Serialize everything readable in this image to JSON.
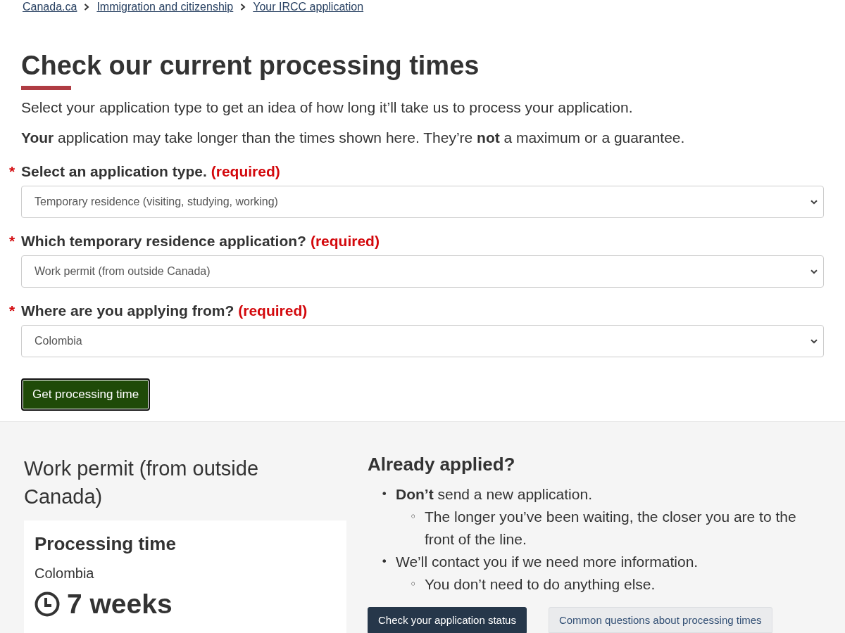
{
  "breadcrumb": [
    "Canada.ca",
    "Immigration and citizenship",
    "Your IRCC application"
  ],
  "page_title": "Check our current processing times",
  "intro": "Select your application type to get an idea of how long it’ll take us to process your application.",
  "notice": "**Your** application may take longer than the times shown here. They’re **not** a maximum or a guarantee.",
  "form": {
    "fields": [
      {
        "marker": "*",
        "label": "Select an application type.",
        "required_note": "(required)",
        "value": "Temporary residence (visiting, studying, working)"
      },
      {
        "marker": "*",
        "label": "Which temporary residence application?",
        "required_note": "(required)",
        "value": "Work permit (from outside Canada)"
      },
      {
        "marker": "*",
        "label": "Where are you applying from?",
        "required_note": "(required)",
        "value": "Colombia"
      }
    ],
    "submit_button": "Get processing time"
  },
  "result": {
    "heading": "Work permit (from outside Canada)",
    "card": {
      "title": "Processing time",
      "country": "Colombia",
      "time": "7 weeks"
    }
  },
  "already_applied": {
    "heading": "Already applied?",
    "items": [
      {
        "marker": "•",
        "text": "**Don’t** send a new application.",
        "children": [
          {
            "marker": "◦",
            "text": "The longer you’ve been waiting, the closer you are to the front of the line."
          }
        ]
      },
      {
        "marker": "•",
        "text": "We’ll contact you if we need more information.",
        "children": [
          {
            "marker": "◦",
            "text": "You don’t need to do anything else."
          }
        ]
      }
    ],
    "buttons": [
      {
        "label": "Check your application status",
        "kind": "primary"
      },
      {
        "label": "Common questions about processing times",
        "kind": "secondary"
      }
    ]
  }
}
